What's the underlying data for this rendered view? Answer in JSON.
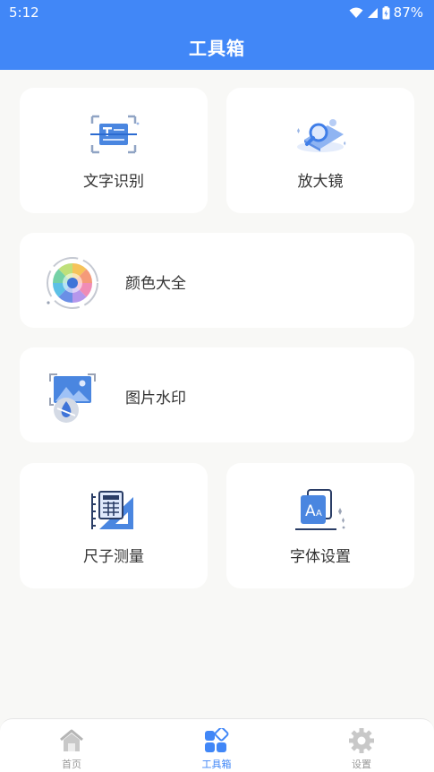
{
  "status_bar": {
    "time": "5:12",
    "battery": "87%"
  },
  "header": {
    "title": "工具箱"
  },
  "tools": {
    "ocr": {
      "label": "文字识别",
      "icon": "text-scan-icon"
    },
    "magnifier": {
      "label": "放大镜",
      "icon": "magnifier-icon"
    },
    "colors": {
      "label": "颜色大全",
      "icon": "color-wheel-icon"
    },
    "watermark": {
      "label": "图片水印",
      "icon": "image-watermark-icon"
    },
    "ruler": {
      "label": "尺子测量",
      "icon": "ruler-icon"
    },
    "font": {
      "label": "字体设置",
      "icon": "font-icon"
    }
  },
  "tabbar": {
    "home": {
      "label": "首页",
      "icon": "home-icon"
    },
    "toolbox": {
      "label": "工具箱",
      "icon": "toolbox-icon",
      "active": true
    },
    "settings": {
      "label": "设置",
      "icon": "gear-icon"
    }
  },
  "colors": {
    "accent": "#4187f7",
    "background": "#f8f8f6"
  }
}
